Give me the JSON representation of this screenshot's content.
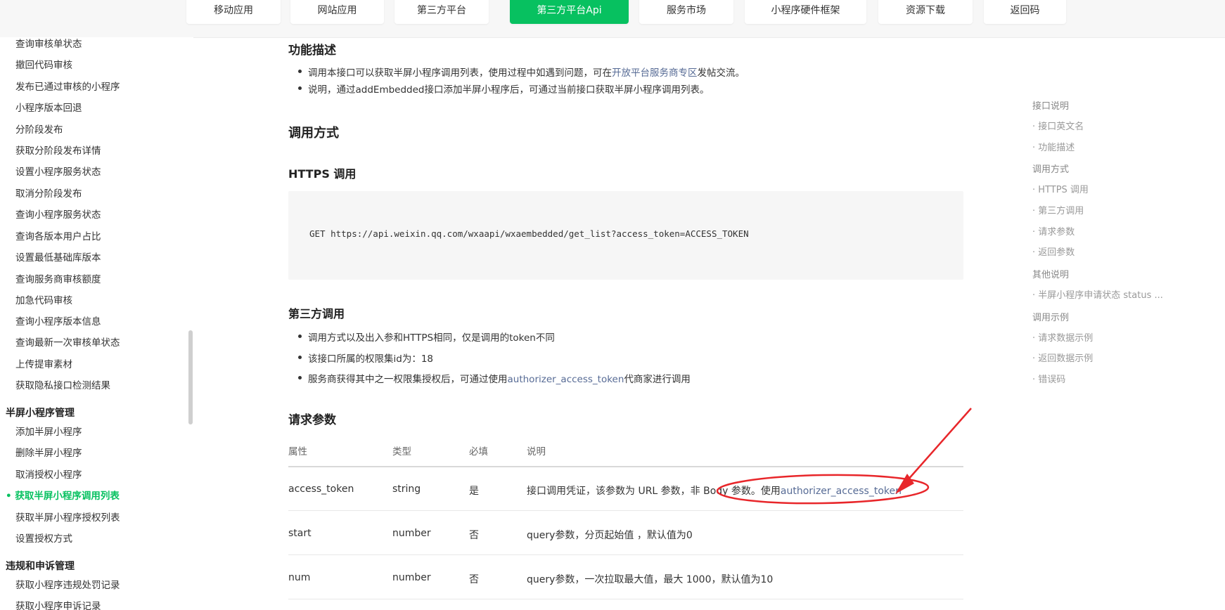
{
  "topnav": {
    "tabs": [
      {
        "label": "移动应用"
      },
      {
        "label": "网站应用"
      },
      {
        "label": "第三方平台"
      },
      {
        "label": "第三方平台Api"
      },
      {
        "label": "服务市场"
      },
      {
        "label": "小程序硬件框架"
      },
      {
        "label": "资源下载"
      },
      {
        "label": "返回码"
      }
    ],
    "active_index": 3
  },
  "sidebar": {
    "items_a": [
      "查询审核单状态",
      "撤回代码审核",
      "发布已通过审核的小程序",
      "小程序版本回退",
      "分阶段发布",
      "获取分阶段发布详情",
      "设置小程序服务状态",
      "取消分阶段发布",
      "查询小程序服务状态",
      "查询各版本用户占比",
      "设置最低基础库版本",
      "查询服务商审核额度",
      "加急代码审核",
      "查询小程序版本信息",
      "查询最新一次审核单状态",
      "上传提审素材",
      "获取隐私接口检测结果"
    ],
    "group_1": "半屏小程序管理",
    "items_b": [
      "添加半屏小程序",
      "删除半屏小程序",
      "取消授权小程序"
    ],
    "active_item": "获取半屏小程序调用列表",
    "items_c": [
      "获取半屏小程序授权列表",
      "设置授权方式"
    ],
    "group_2": "违规和申诉管理",
    "items_d": [
      "获取小程序违规处罚记录",
      "获取小程序申诉记录"
    ]
  },
  "main": {
    "func_desc_title": "功能描述",
    "func_desc_1_pre": "调用本接口可以获取半屏小程序调用列表，使用过程中如遇到问题，可在",
    "func_desc_1_link": "开放平台服务商专区",
    "func_desc_1_post": "发帖交流。",
    "func_desc_2": "说明，通过addEmbedded接口添加半屏小程序后，可通过当前接口获取半屏小程序调用列表。",
    "call_method_title": "调用方式",
    "https_title": "HTTPS 调用",
    "https_code": "GET https://api.weixin.qq.com/wxaapi/wxaembedded/get_list?access_token=ACCESS_TOKEN",
    "third_title": "第三方调用",
    "third_1": "调用方式以及出入参和HTTPS相同，仅是调用的token不同",
    "third_2": "该接口所属的权限集id为：18",
    "third_3_pre": "服务商获得其中之一权限集授权后，可通过使用",
    "third_3_link": "authorizer_access_token",
    "third_3_post": "代商家进行调用",
    "params_title": "请求参数",
    "table": {
      "headers": [
        "属性",
        "类型",
        "必填",
        "说明"
      ],
      "rows": [
        {
          "name": "access_token",
          "type": "string",
          "required": "是",
          "desc": "接口调用凭证，该参数为 URL 参数，非 Body 参数。使用",
          "desc_link": "authorizer_access_token"
        },
        {
          "name": "start",
          "type": "number",
          "required": "否",
          "desc": "query参数，分页起始值 ，默认值为0",
          "desc_link": ""
        },
        {
          "name": "num",
          "type": "number",
          "required": "否",
          "desc": "query参数，一次拉取最大值，最大 1000，默认值为10",
          "desc_link": ""
        }
      ]
    }
  },
  "toc": {
    "entries": [
      {
        "level": 1,
        "label": "接口说明"
      },
      {
        "level": 2,
        "label": "接口英文名"
      },
      {
        "level": 2,
        "label": "功能描述"
      },
      {
        "level": 1,
        "label": "调用方式"
      },
      {
        "level": 2,
        "label": "HTTPS 调用"
      },
      {
        "level": 2,
        "label": "第三方调用"
      },
      {
        "level": 2,
        "label": "请求参数"
      },
      {
        "level": 2,
        "label": "返回参数"
      },
      {
        "level": 1,
        "label": "其他说明"
      },
      {
        "level": 2,
        "label": "半屏小程序申请状态 status ..."
      },
      {
        "level": 1,
        "label": "调用示例"
      },
      {
        "level": 2,
        "label": "请求数据示例"
      },
      {
        "level": 2,
        "label": "返回数据示例"
      },
      {
        "level": 2,
        "label": "错误码"
      }
    ]
  },
  "colors": {
    "accent": "#07c160",
    "link": "#576b95",
    "annotation": "#e8262a"
  }
}
